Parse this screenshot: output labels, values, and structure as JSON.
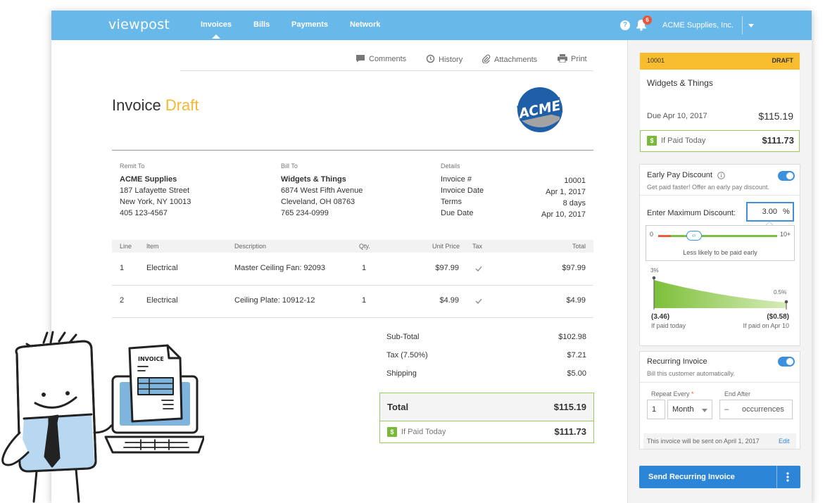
{
  "nav": {
    "logo": "viewpost",
    "links": [
      "Invoices",
      "Bills",
      "Payments",
      "Network"
    ],
    "help": "?",
    "notifications": "6",
    "company": "ACME Supplies, Inc."
  },
  "actions": {
    "comments": "Comments",
    "history": "History",
    "attachments": "Attachments",
    "print": "Print"
  },
  "invoice": {
    "title": "Invoice",
    "status": "Draft",
    "logo_text": "ACME",
    "remit": {
      "label": "Remit To",
      "name": "ACME Supplies",
      "line1": "187 Lafayette Street",
      "line2": "New York, NY 10013",
      "phone": "405 123-4567"
    },
    "bill": {
      "label": "Bill To",
      "name": "Widgets & Things",
      "line1": "6874 West Fifth Avenue",
      "line2": "Cleveland, OH 08763",
      "phone": "765 234-0999"
    },
    "details": {
      "label": "Details",
      "rows": [
        {
          "k": "Invoice #",
          "v": "10001"
        },
        {
          "k": "Invoice Date",
          "v": "Apr 1, 2017"
        },
        {
          "k": "Terms",
          "v": "8 days"
        },
        {
          "k": "Due Date",
          "v": "Apr 10, 2017"
        }
      ]
    },
    "columns": {
      "line": "Line",
      "item": "Item",
      "desc": "Description",
      "qty": "Qty.",
      "price": "Unit Price",
      "tax": "Tax",
      "total": "Total"
    },
    "lines": [
      {
        "line": "1",
        "item": "Electrical",
        "desc": "Master Ceiling Fan: 92093",
        "qty": "1",
        "price": "$97.99",
        "total": "$97.99"
      },
      {
        "line": "2",
        "item": "Electrical",
        "desc": "Ceiling Plate: 10912-12",
        "qty": "1",
        "price": "$4.99",
        "total": "$4.99"
      }
    ],
    "subtotal": {
      "label": "Sub-Total",
      "value": "$102.98"
    },
    "tax": {
      "label": "Tax (7.50%)",
      "value": "$7.21"
    },
    "shipping": {
      "label": "Shipping",
      "value": "$5.00"
    },
    "total": {
      "label": "Total",
      "value": "$115.19"
    },
    "paid_today": {
      "label": "If Paid Today",
      "value": "$111.73",
      "icon": "$"
    }
  },
  "sidebar": {
    "summary": {
      "number": "10001",
      "status": "DRAFT",
      "customer": "Widgets & Things",
      "due": "Due Apr 10, 2017",
      "amount": "$115.19",
      "paid_today_label": "If Paid Today",
      "paid_today_value": "$111.73"
    },
    "early_pay": {
      "title": "Early Pay Discount",
      "subtitle": "Get paid faster! Offer an early pay discount.",
      "max_label": "Enter Maximum Discount:",
      "max_value": "3.00",
      "unit": "%",
      "slider_min": "0",
      "slider_max": "10+",
      "slider_level": 0.3,
      "slider_caption": "Less likely to be paid early",
      "chart_start_pct": "3%",
      "chart_end_pct": "0.5%",
      "start_amount": "(3.46)",
      "start_caption": "If paid today",
      "end_amount": "($0.58)",
      "end_caption": "If paid on Apr 10"
    },
    "recurring": {
      "title": "Recurring Invoice",
      "subtitle": "Bill this customer automatically.",
      "repeat_label": "Repeat Every",
      "required_mark": "*",
      "end_label": "End After",
      "repeat_count": "1",
      "repeat_unit": "Month",
      "end_dash": "–",
      "end_placeholder": "occurrences",
      "note": "This invoice will be sent on April 1, 2017",
      "edit": "Edit"
    },
    "send_button": "Send Recurring Invoice"
  },
  "illustration": {
    "doc_label": "INVOICE"
  }
}
